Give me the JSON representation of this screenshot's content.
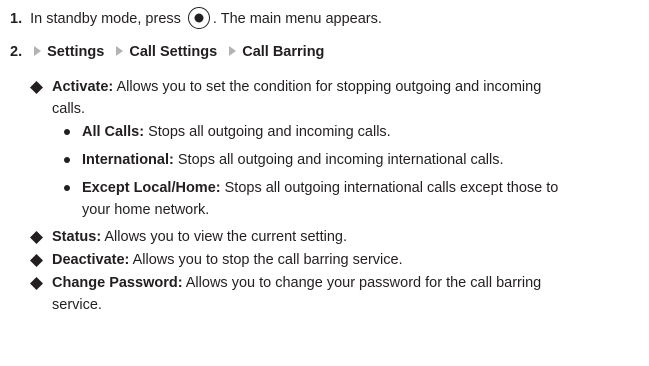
{
  "step1": {
    "number": "1.",
    "text_before": "In standby mode, press",
    "icon": "center-select-key-icon",
    "text_after": ". The main menu appears."
  },
  "step2": {
    "number": "2.",
    "path": [
      "Settings",
      "Call Settings",
      "Call Barring"
    ]
  },
  "items": [
    {
      "label": "Activate:",
      "text_line1": "Allows you to set the condition for stopping outgoing and incoming",
      "text_line2": "calls.",
      "subitems": [
        {
          "label": "All Calls:",
          "text": "Stops all outgoing and incoming calls."
        },
        {
          "label": "International:",
          "text": "Stops all outgoing and incoming international calls."
        },
        {
          "label": "Except Local/Home:",
          "text": "Stops all outgoing international calls except those to",
          "text_line2": "your home network."
        }
      ]
    },
    {
      "label": "Status:",
      "text": "Allows you to view the current setting."
    },
    {
      "label": "Deactivate:",
      "text": "Allows you to stop the call barring service."
    },
    {
      "label": "Change Password:",
      "text_line1": "Allows you to change your password for the call barring",
      "text_line2": "service."
    }
  ]
}
